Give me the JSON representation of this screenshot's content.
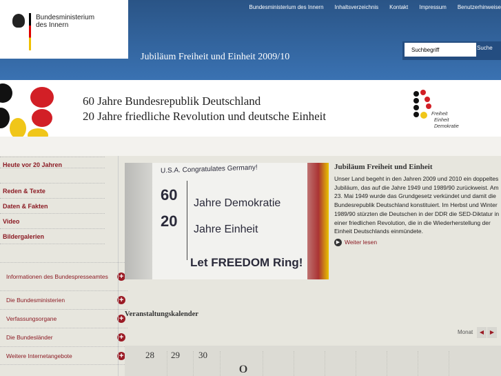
{
  "logo": {
    "line1": "Bundesministerium",
    "line2": "des Innern"
  },
  "topnav": [
    "Bundesministerium des Innern",
    "Inhaltsverzeichnis",
    "Kontakt",
    "Impressum",
    "Benutzerhinweise"
  ],
  "site_title": "Jubiläum Freiheit und Einheit 2009/10",
  "search": {
    "placeholder": "Suchbegriff",
    "button": "Suche"
  },
  "banner": {
    "line1": "60 Jahre Bundesrepublik Deutschland",
    "line2": "20 Jahre friedliche Revolution und deutsche Einheit",
    "logo_words": [
      "Freiheit",
      "Einheit",
      "Demokratie"
    ]
  },
  "nav_primary": [
    "Heute vor 20 Jahren",
    "Reden & Texte",
    "Daten & Fakten",
    "Video",
    "Bildergalerien"
  ],
  "nav_secondary": [
    "Informationen des Bundespresseamtes",
    "Die Bundesministerien",
    "Verfassungsorgane",
    "Die Bundesländer",
    "Weitere Internetangebote"
  ],
  "photo_sign": {
    "top": "U.S.A. Congratulates Germany!",
    "n1": "60",
    "t1": "Jahre Demokratie",
    "n2": "20",
    "t2": "Jahre Einheit",
    "bottom": "Let FREEDOM Ring!"
  },
  "article": {
    "title": "Jubiläum Freiheit und Einheit",
    "body": "Unser Land begeht in den Jahren 2009 und 2010 ein doppeltes Jubiläum, das auf die Jahre 1949 und 1989/90 zurückweist. Am 23. Mai 1949 wurde das Grundgesetz verkündet und damit die Bundesrepublik Deutschland konstituiert. Im Herbst und Winter 1989/90 stürzten die Deutschen in der DDR die SED-Diktatur in einer friedlichen Revolution, die in die Wiederherstellung der Einheit Deutschlands einmündete.",
    "more": "Weiter lesen"
  },
  "calendar": {
    "title": "Veranstaltungskalender",
    "view": "Monat",
    "days": [
      "28",
      "29",
      "30"
    ],
    "marker": "0"
  }
}
